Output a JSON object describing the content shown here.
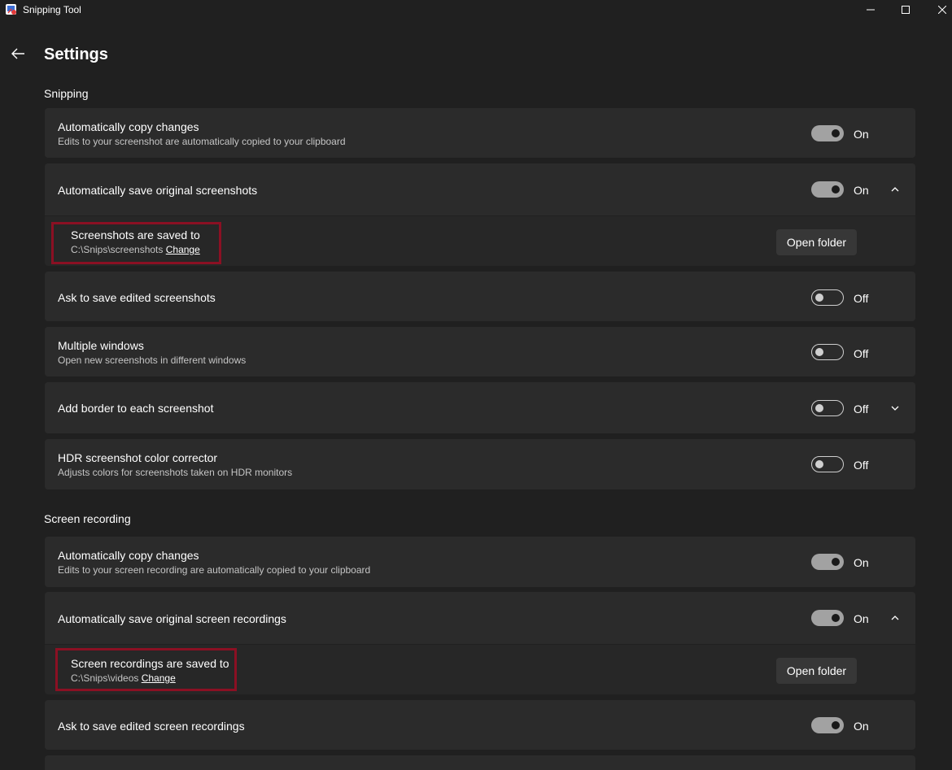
{
  "window": {
    "title": "Snipping Tool"
  },
  "page": {
    "title": "Settings"
  },
  "sections": {
    "snipping": "Snipping",
    "screen_recording": "Screen recording"
  },
  "snipping": {
    "copy": {
      "label": "Automatically copy changes",
      "desc": "Edits to your screenshot are automatically copied to your clipboard",
      "state": "On"
    },
    "autosave": {
      "label": "Automatically save original screenshots",
      "state": "On"
    },
    "location": {
      "label": "Screenshots are saved to",
      "path": "C:\\Snips\\screenshots",
      "change": "Change",
      "button": "Open folder"
    },
    "ask_save": {
      "label": "Ask to save edited screenshots",
      "state": "Off"
    },
    "multi": {
      "label": "Multiple windows",
      "desc": "Open new screenshots in different windows",
      "state": "Off"
    },
    "border": {
      "label": "Add border to each screenshot",
      "state": "Off"
    },
    "hdr": {
      "label": "HDR screenshot color corrector",
      "desc": "Adjusts colors for screenshots taken on HDR monitors",
      "state": "Off"
    }
  },
  "recording": {
    "copy": {
      "label": "Automatically copy changes",
      "desc": "Edits to your screen recording are automatically copied to your clipboard",
      "state": "On"
    },
    "autosave": {
      "label": "Automatically save original screen recordings",
      "state": "On"
    },
    "location": {
      "label": "Screen recordings are saved to",
      "path": "C:\\Snips\\videos",
      "change": "Change",
      "button": "Open folder"
    },
    "ask_save": {
      "label": "Ask to save edited screen recordings",
      "state": "On"
    }
  },
  "colors": {
    "background": "#202020",
    "card": "#2b2b2b",
    "toggle_on": "#a2a2a2",
    "highlight": "#8b1023"
  },
  "icons": {
    "app": "snipping-tool-app-icon",
    "back": "back-arrow-icon",
    "expand": "chevron-up-icon",
    "collapse": "chevron-down-icon"
  }
}
